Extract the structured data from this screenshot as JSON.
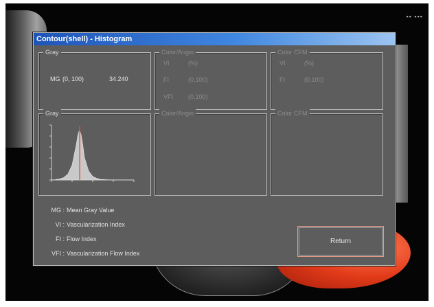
{
  "window": {
    "title": "Contour(shell) - Histogram"
  },
  "top_groups": [
    {
      "title": "Gray",
      "rows": [
        {
          "label": "MG",
          "range": "(0, 100)",
          "value": "34.240"
        }
      ]
    },
    {
      "title": "Color/Angio",
      "rows": [
        {
          "label": "VI",
          "value": "(%)"
        },
        {
          "label": "FI",
          "value": "(0,100)"
        },
        {
          "label": "VFI",
          "value": "(0,100)"
        }
      ]
    },
    {
      "title": "Color CFM",
      "rows": [
        {
          "label": "VI",
          "value": "(%)"
        },
        {
          "label": "FI",
          "value": "(0,100)"
        }
      ]
    }
  ],
  "histogram_groups": [
    {
      "title": "Gray"
    },
    {
      "title": "Color/Angio"
    },
    {
      "title": "Color CFM"
    }
  ],
  "legend": [
    {
      "abbr": "MG :",
      "text": "Mean Gray Value"
    },
    {
      "abbr": "VI :",
      "text": "Vascularization Index"
    },
    {
      "abbr": "FI :",
      "text": "Flow Index"
    },
    {
      "abbr": "VFI :",
      "text": "Vascularization Flow Index"
    }
  ],
  "buttons": {
    "return": "Return"
  },
  "colors": {
    "titlebar": "#2a6ad0",
    "panel": "#5d5d5d",
    "histogram_fill": "#c9c9c9",
    "mean_line": "#e0553a",
    "button_border": "#e49a82"
  },
  "chart_data": {
    "type": "area",
    "x": [
      0,
      5,
      10,
      15,
      20,
      25,
      30,
      32,
      34,
      36,
      38,
      40,
      45,
      50,
      55,
      60,
      70,
      80,
      90,
      100
    ],
    "values": [
      0,
      0.5,
      2,
      5,
      12,
      30,
      70,
      90,
      100,
      90,
      70,
      45,
      18,
      7,
      3,
      1,
      0.3,
      0,
      0,
      0
    ],
    "mean_marker": 34.24,
    "xlim": [
      0,
      100
    ],
    "ylim": [
      0,
      110
    ],
    "grid": false
  }
}
